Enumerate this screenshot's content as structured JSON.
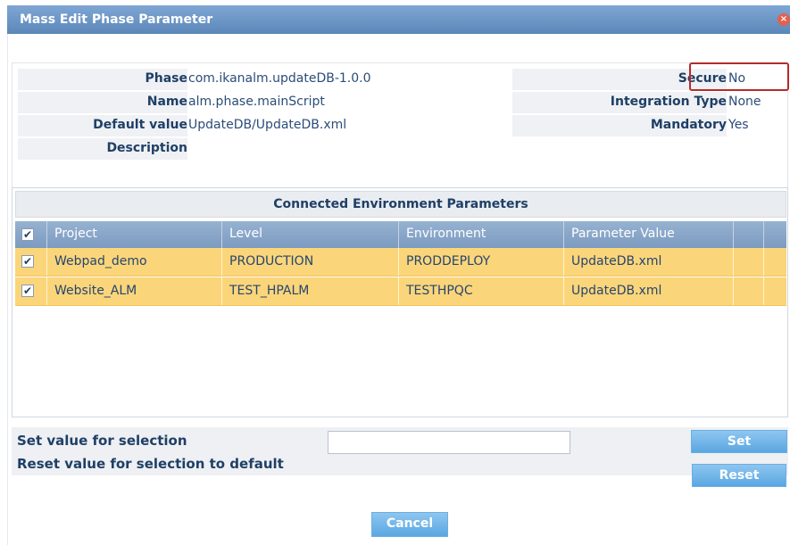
{
  "dialog": {
    "title": "Mass Edit Phase Parameter",
    "close_glyph": "×"
  },
  "info": {
    "phase_label": "Phase",
    "phase_value": "com.ikanalm.updateDB-1.0.0",
    "name_label": "Name",
    "name_value": "alm.phase.mainScript",
    "default_label": "Default value",
    "default_value": "UpdateDB/UpdateDB.xml",
    "description_label": "Description",
    "description_value": "",
    "secure_label": "Secure",
    "secure_value": "No",
    "integration_label": "Integration Type",
    "integration_value": "None",
    "mandatory_label": "Mandatory",
    "mandatory_value": "Yes"
  },
  "grid": {
    "title": "Connected Environment Parameters",
    "columns": [
      "Project",
      "Level",
      "Environment",
      "Parameter Value"
    ],
    "select_all_checked": "✔",
    "rows": [
      {
        "check": "✔",
        "project": "Webpad_demo",
        "level": "PRODUCTION",
        "environment": "PRODDEPLOY",
        "value": "UpdateDB.xml"
      },
      {
        "check": "✔",
        "project": "Website_ALM",
        "level": "TEST_HPALM",
        "environment": "TESTHPQC",
        "value": "UpdateDB.xml"
      }
    ]
  },
  "actions": {
    "set_label": "Set value for selection",
    "set_input_value": "",
    "set_button": "Set",
    "reset_label": "Reset value for selection to default",
    "reset_button": "Reset",
    "cancel_button": "Cancel"
  }
}
